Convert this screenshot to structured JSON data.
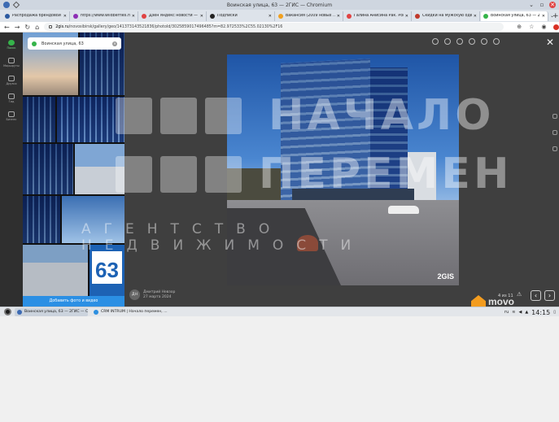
{
  "window": {
    "title": "Воинская улица, 63 — 2ГИС — Chromium",
    "controls": [
      "⌄",
      "▫",
      "✕"
    ]
  },
  "tabs": [
    {
      "label": "Распродажа брендовой ...",
      "color": "#2c5aa0"
    },
    {
      "label": "https://www.wildberries.ru",
      "color": "#8e2fb5"
    },
    {
      "label": "Дзен яндекс новости — Я...",
      "color": "#e04343"
    },
    {
      "label": "Подписки",
      "color": "#222222"
    },
    {
      "label": "Вакансия (2009 новых ...",
      "color": "#f0a020"
    },
    {
      "label": "Галина Анисина Рак. Рос...",
      "color": "#e04343"
    },
    {
      "label": "Скидки на мужскую одеж...",
      "color": "#c0392b"
    },
    {
      "label": "Воинская улица, 63 — 2ГИ...",
      "color": "#35b44a",
      "active": true
    }
  ],
  "address_bar": {
    "host": "2gis.ru",
    "path": "/novosibirsk/gallery/geo/141373143521836/photoId/3025859017496485?m=82.972533%2C55.02130%2F16"
  },
  "rail": [
    {
      "label": "Поиск",
      "active": true
    },
    {
      "label": "Маршруты"
    },
    {
      "label": "Друзья"
    },
    {
      "label": "Гид"
    },
    {
      "label": "Бизнес"
    }
  ],
  "gallery": {
    "search_value": "Воинская улица, 63",
    "add_button": "Добавить фото и видео"
  },
  "watermark": {
    "word_top": "НАЧАЛО",
    "word_bottom": "ПЕРЕМЕН",
    "subtitle": "АГЕНТСТВО НЕДВИЖИМОСТИ"
  },
  "photo": {
    "brand": "2GIS"
  },
  "author": {
    "initials": "ДН",
    "name": "Дмитрий Невзор",
    "date": "27 марта 2024"
  },
  "viewer": {
    "counter": "4 из 11",
    "close": "✕",
    "prev": "‹",
    "next": "›"
  },
  "logo_text": "movo",
  "taskbar": {
    "apps": [
      {
        "label": "Воинская улица, 63 — 2ГИС — Chr...",
        "color": "#3d6bb3",
        "active": true
      },
      {
        "label": "CRM INTRUM | Начало перемен, ...",
        "color": "#2c8fe0"
      }
    ],
    "tray_lang": "ru",
    "clock": "14:15"
  }
}
